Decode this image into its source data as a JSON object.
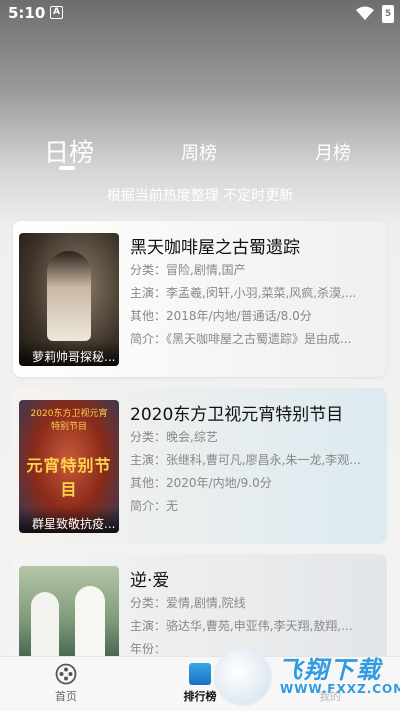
{
  "status_bar": {
    "time": "5:10",
    "notification_letter": "A",
    "battery_label": "5"
  },
  "tabs": [
    {
      "label": "日榜",
      "active": true
    },
    {
      "label": "周榜",
      "active": false
    },
    {
      "label": "月榜",
      "active": false
    }
  ],
  "subtitle": "根据当前热度整理 不定时更新",
  "cards": [
    {
      "poster_caption": "萝莉帅哥探秘...",
      "title": "黑天咖啡屋之古蜀遗踪",
      "rows": [
        {
          "key": "分类：",
          "value": "冒险,剧情,国产"
        },
        {
          "key": "主演：",
          "value": "李孟羲,闵轩,小羽,菜菜,风疯,杀漠,..."
        },
        {
          "key": "其他：",
          "value": "2018年/内地/普通话/8.0分"
        },
        {
          "key": "简介：",
          "value": "《黑天咖啡屋之古蜀遗踪》是由成..."
        }
      ]
    },
    {
      "poster_caption": "群星致敬抗疫...",
      "poster_text": "元宵特别节目",
      "poster_top_text": "2020东方卫视元宵特别节目",
      "title": "2020东方卫视元宵特别节目",
      "rows": [
        {
          "key": "分类：",
          "value": "晚会,综艺"
        },
        {
          "key": "主演：",
          "value": "张继科,曹可凡,廖昌永,朱一龙,李观..."
        },
        {
          "key": "其他：",
          "value": "2020年/内地/9.0分"
        },
        {
          "key": "简介：",
          "value": "无"
        }
      ]
    },
    {
      "title": "逆·爱",
      "rows": [
        {
          "key": "分类：",
          "value": "爱情,剧情,院线"
        },
        {
          "key": "主演：",
          "value": "骆达华,曹苑,申亚伟,李天翔,敖翔,..."
        },
        {
          "key": "年份：",
          "value": ""
        }
      ]
    }
  ],
  "bottom_nav": [
    {
      "label": "首页",
      "icon": "film-reel-icon"
    },
    {
      "label": "排行榜",
      "icon": "ranking-icon"
    },
    {
      "label": "我的",
      "icon": "user-icon"
    }
  ],
  "watermark": {
    "title": "飞翔下载",
    "url": "WWW.FXXZ.COM"
  },
  "colors": {
    "accent": "#2f9be0",
    "active_nav": "#1a6fc4"
  }
}
